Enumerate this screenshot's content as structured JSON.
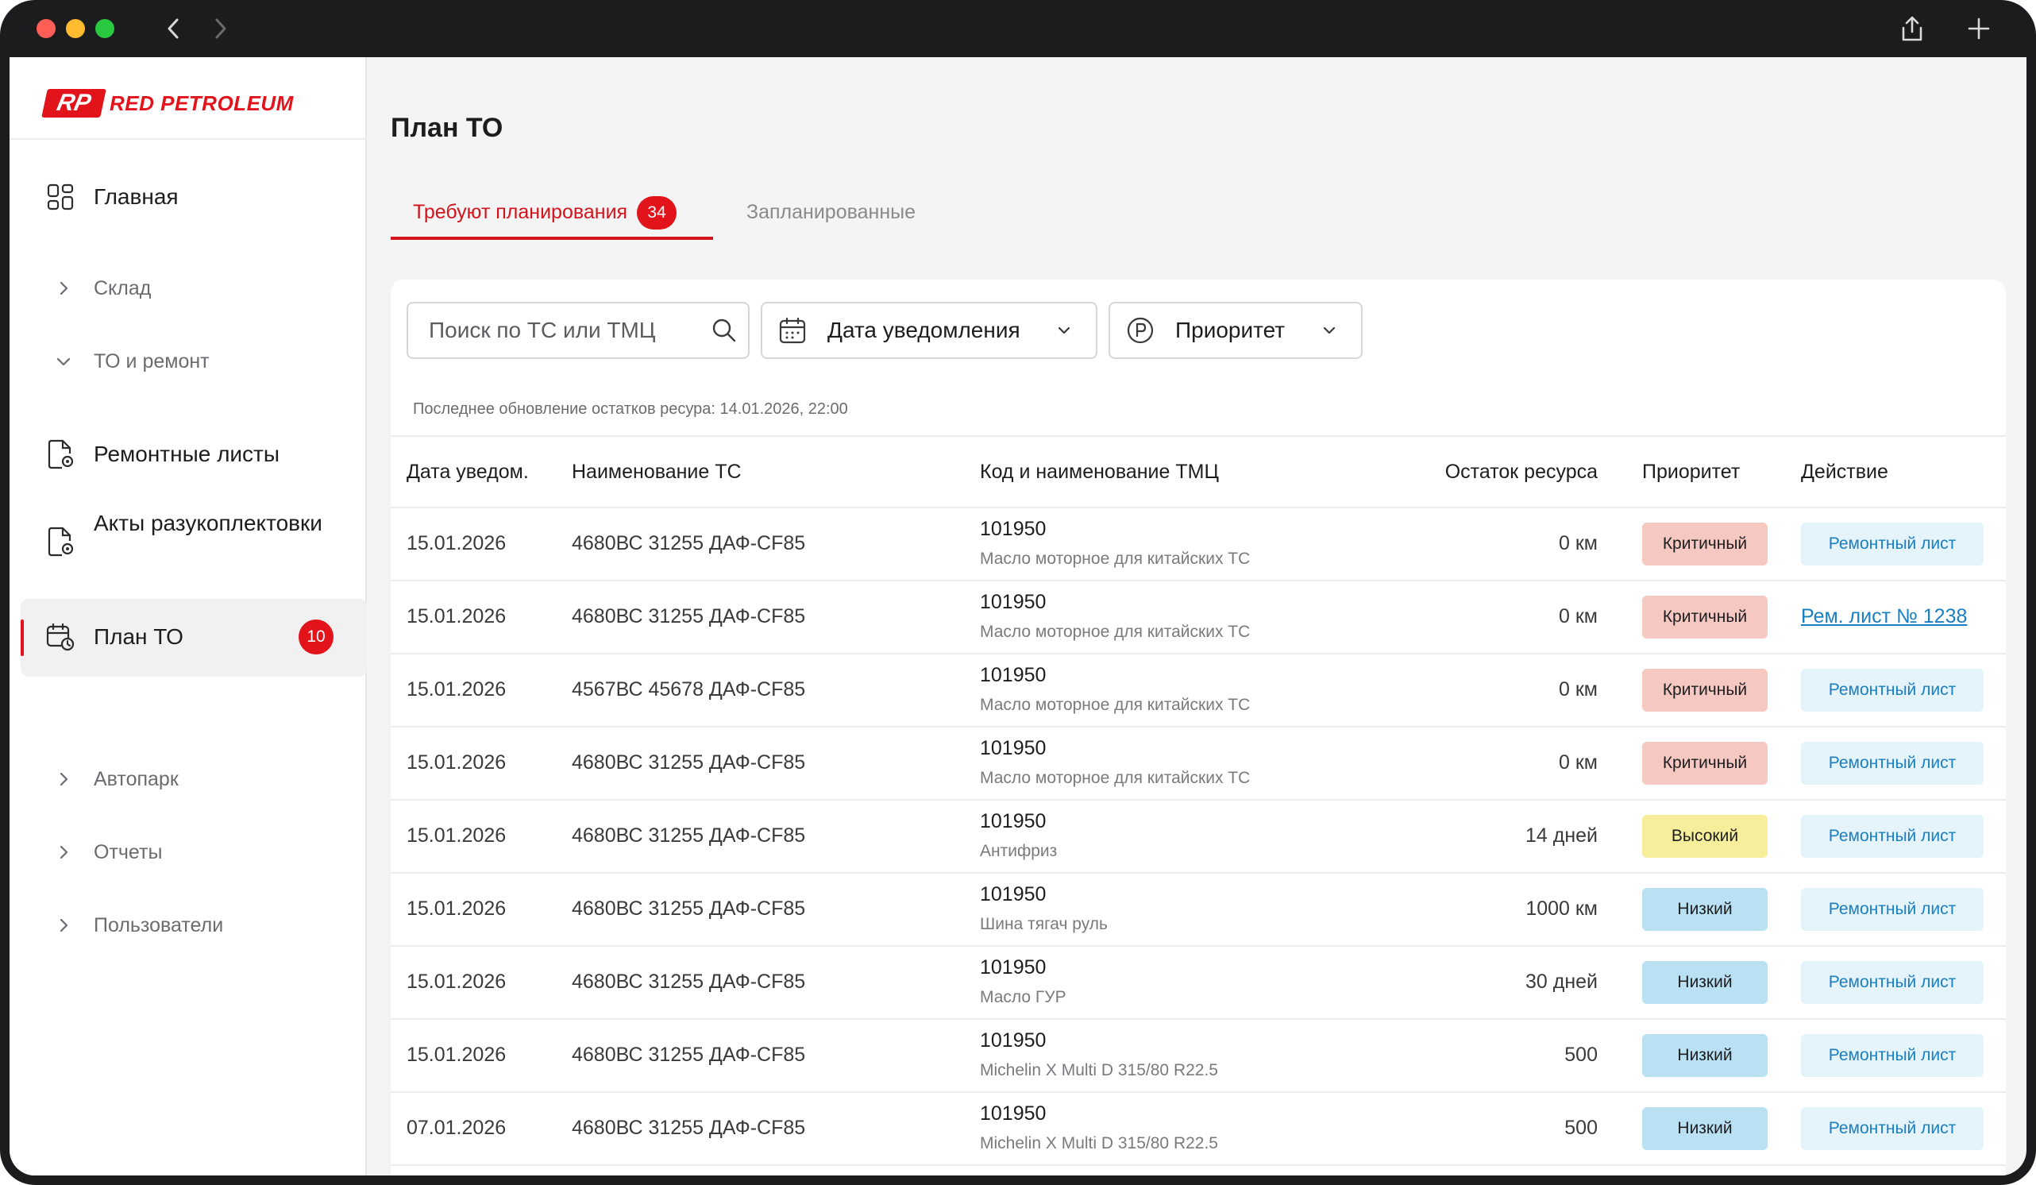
{
  "sidebar": {
    "logo_mark": "RP",
    "logo_text": "RED PETROLEUM",
    "items": [
      {
        "label": "Главная",
        "icon": "grid-icon"
      },
      {
        "label": "Склад",
        "icon": "chevron-right-icon"
      },
      {
        "label": "ТО и ремонт",
        "icon": "chevron-down-icon"
      },
      {
        "label": "Ремонтные листы",
        "icon": "document-gear-icon"
      },
      {
        "label": "Акты разукоплектовки",
        "icon": "document-gear-icon"
      },
      {
        "label": "План ТО",
        "icon": "calendar-clock-icon",
        "badge": "10"
      },
      {
        "label": "Автопарк",
        "icon": "chevron-right-icon"
      },
      {
        "label": "Отчеты",
        "icon": "chevron-right-icon"
      },
      {
        "label": "Пользователи",
        "icon": "chevron-right-icon"
      }
    ]
  },
  "main": {
    "title": "План ТО",
    "tabs": [
      {
        "label": "Требуют планирования",
        "badge": "34",
        "active": true
      },
      {
        "label": "Запланированные",
        "active": false
      }
    ],
    "filters": {
      "search_placeholder": "Поиск по ТС или ТМЦ",
      "date_label": "Дата уведомления",
      "priority_label": "Приоритет"
    },
    "update_note": "Последнее обновление остатков ресура: 14.01.2026, 22:00",
    "columns": [
      "Дата уведом.",
      "Наименование ТС",
      "Код и наименование ТМЦ",
      "Остаток ресурса",
      "Приоритет",
      "Действие"
    ],
    "rows": [
      {
        "date": "15.01.2026",
        "ts": "4680ВС 31255 ДАФ-CF85",
        "code": "101950",
        "name": "Масло моторное для китайских ТС",
        "rest": "0 км",
        "priority": "Критичный",
        "action": "Ремонтный лист"
      },
      {
        "date": "15.01.2026",
        "ts": "4680ВС 31255 ДАФ-CF85",
        "code": "101950",
        "name": "Масло моторное для китайских ТС",
        "rest": "0 км",
        "priority": "Критичный",
        "action": "Рем. лист № 1238"
      },
      {
        "date": "15.01.2026",
        "ts": "4567ВС 45678 ДАФ-CF85",
        "code": "101950",
        "name": "Масло моторное для китайских ТС",
        "rest": "0 км",
        "priority": "Критичный",
        "action": "Ремонтный лист"
      },
      {
        "date": "15.01.2026",
        "ts": "4680ВС 31255 ДАФ-CF85",
        "code": "101950",
        "name": "Масло моторное для китайских ТС",
        "rest": "0 км",
        "priority": "Критичный",
        "action": "Ремонтный лист"
      },
      {
        "date": "15.01.2026",
        "ts": "4680ВС 31255 ДАФ-CF85",
        "code": "101950",
        "name": "Антифриз",
        "rest": "14 дней",
        "priority": "Высокий",
        "action": "Ремонтный лист"
      },
      {
        "date": "15.01.2026",
        "ts": "4680ВС 31255 ДАФ-CF85",
        "code": "101950",
        "name": "Шина тягач руль",
        "rest": "1000 км",
        "priority": "Низкий",
        "action": "Ремонтный лист"
      },
      {
        "date": "15.01.2026",
        "ts": "4680ВС 31255 ДАФ-CF85",
        "code": "101950",
        "name": "Масло ГУР",
        "rest": "30 дней",
        "priority": "Низкий",
        "action": "Ремонтный лист"
      },
      {
        "date": "15.01.2026",
        "ts": "4680ВС 31255 ДАФ-CF85",
        "code": "101950",
        "name": "Michelin X Multi D 315/80 R22.5",
        "rest": "500",
        "priority": "Низкий",
        "action": "Ремонтный лист"
      },
      {
        "date": "07.01.2026",
        "ts": "4680ВС 31255 ДАФ-CF85",
        "code": "101950",
        "name": "Michelin X Multi D 315/80 R22.5",
        "rest": "500",
        "priority": "Низкий",
        "action": "Ремонтный лист"
      }
    ]
  },
  "colors": {
    "accent": "#e3131b",
    "critical": "#f5c9c2",
    "high": "#f6ee9b",
    "low": "#b9e0f3",
    "action_bg": "#e5f3fb",
    "action_text": "#1a7fc1"
  }
}
